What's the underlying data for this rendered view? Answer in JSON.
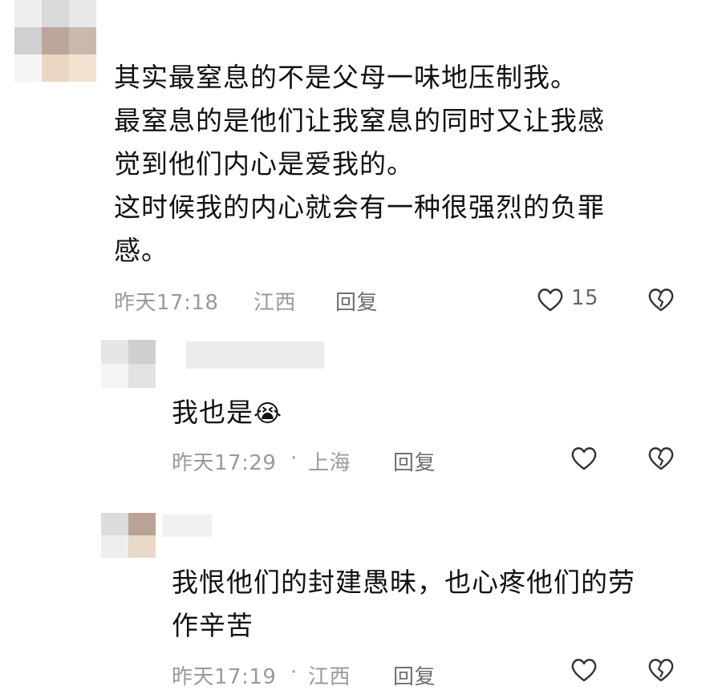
{
  "comments": [
    {
      "text_lines": [
        "其实最窒息的不是父母一味地压制我。",
        "最窒息的是他们让我窒息的同时又让我感",
        "觉到他们内心是爱我的。",
        "这时候我的内心就会有一种很强烈的负罪",
        "感。"
      ],
      "time": "昨天17:18",
      "location": "江西",
      "reply_label": "回复",
      "like_count": "15"
    },
    {
      "text": "我也是",
      "emoji": "😭",
      "time": "昨天17:29",
      "separator": "·",
      "location": "上海",
      "reply_label": "回复"
    },
    {
      "text_lines": [
        "我恨他们的封建愚昧，也心疼他们的劳",
        "作辛苦"
      ],
      "time": "昨天17:19",
      "separator": "·",
      "location": "江西",
      "reply_label": "回复"
    }
  ],
  "colors": {
    "like_icon": "#333333",
    "meta_text": "#9a9a9a"
  },
  "icons": [
    "heart-outline-icon",
    "broken-heart-icon"
  ]
}
